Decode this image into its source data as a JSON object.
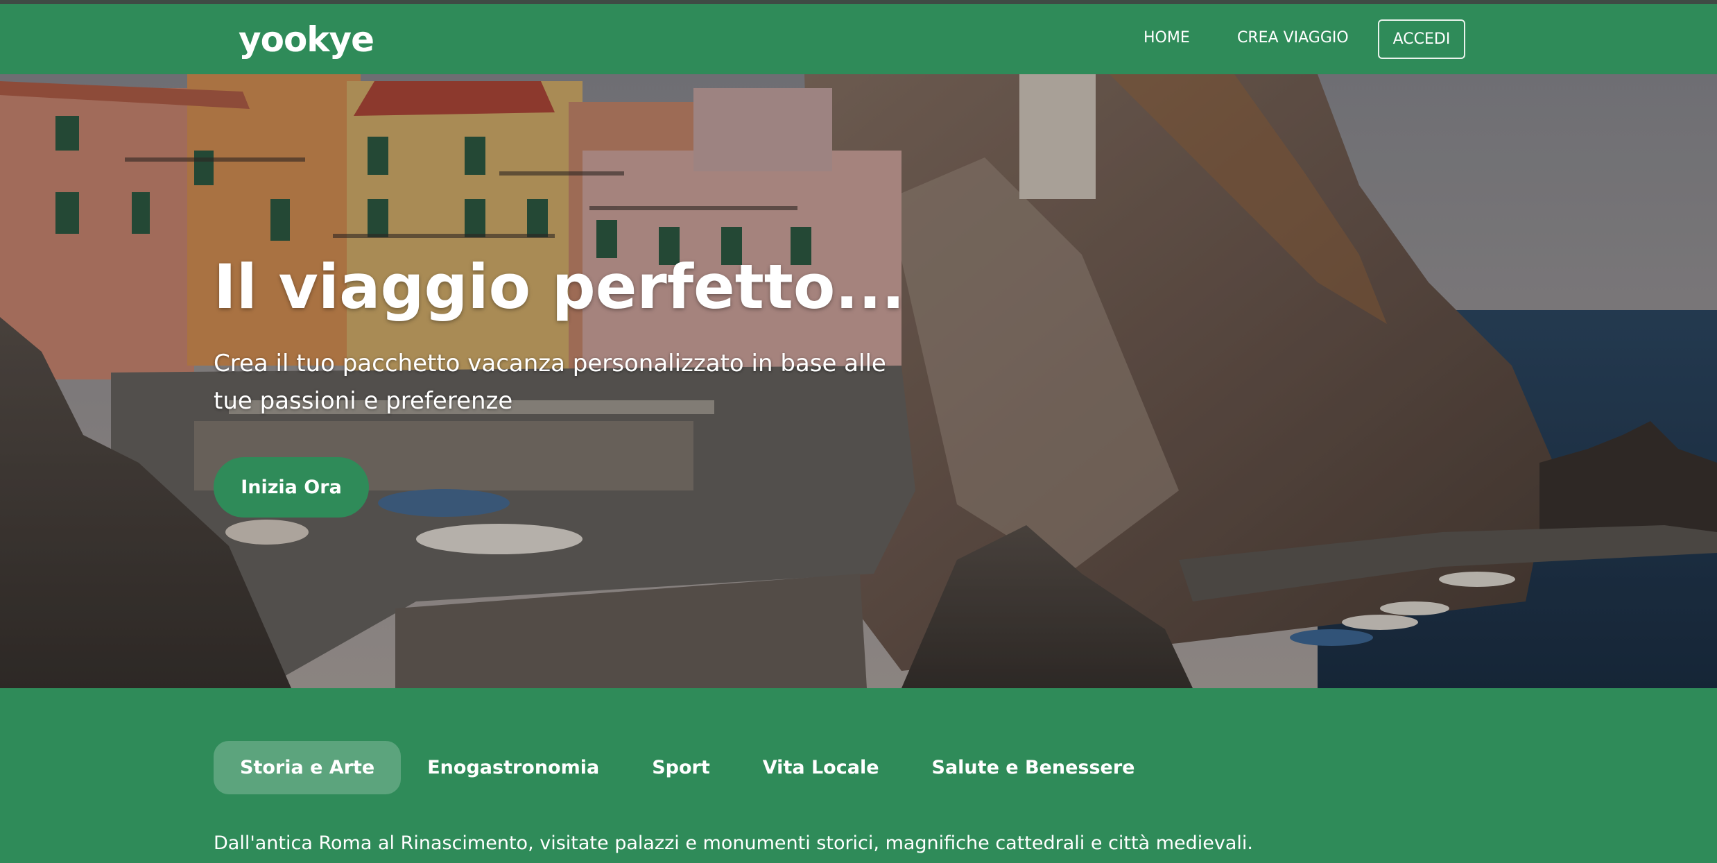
{
  "navbar": {
    "logo": "yookye",
    "links": [
      "HOME",
      "CREA VIAGGIO"
    ],
    "login_label": "ACCEDI"
  },
  "hero": {
    "title": "Il viaggio perfetto...",
    "subtitle": "Crea il tuo pacchetto vacanza personalizzato in base alle tue passioni e preferenze",
    "cta_label": "Inizia Ora",
    "background": "coastal-cliff-village-photo"
  },
  "tabs": {
    "items": [
      "Storia e Arte",
      "Enogastronomia",
      "Sport",
      "Vita Locale",
      "Salute e Benessere"
    ],
    "active_index": 0
  },
  "tab_description": "Dall'antica Roma al Rinascimento, visitate palazzi e monumenti storici, magnifiche cattedrali e città medievali.",
  "colors": {
    "brand_green": "#2f8b59",
    "top_line": "#3f4a44"
  }
}
